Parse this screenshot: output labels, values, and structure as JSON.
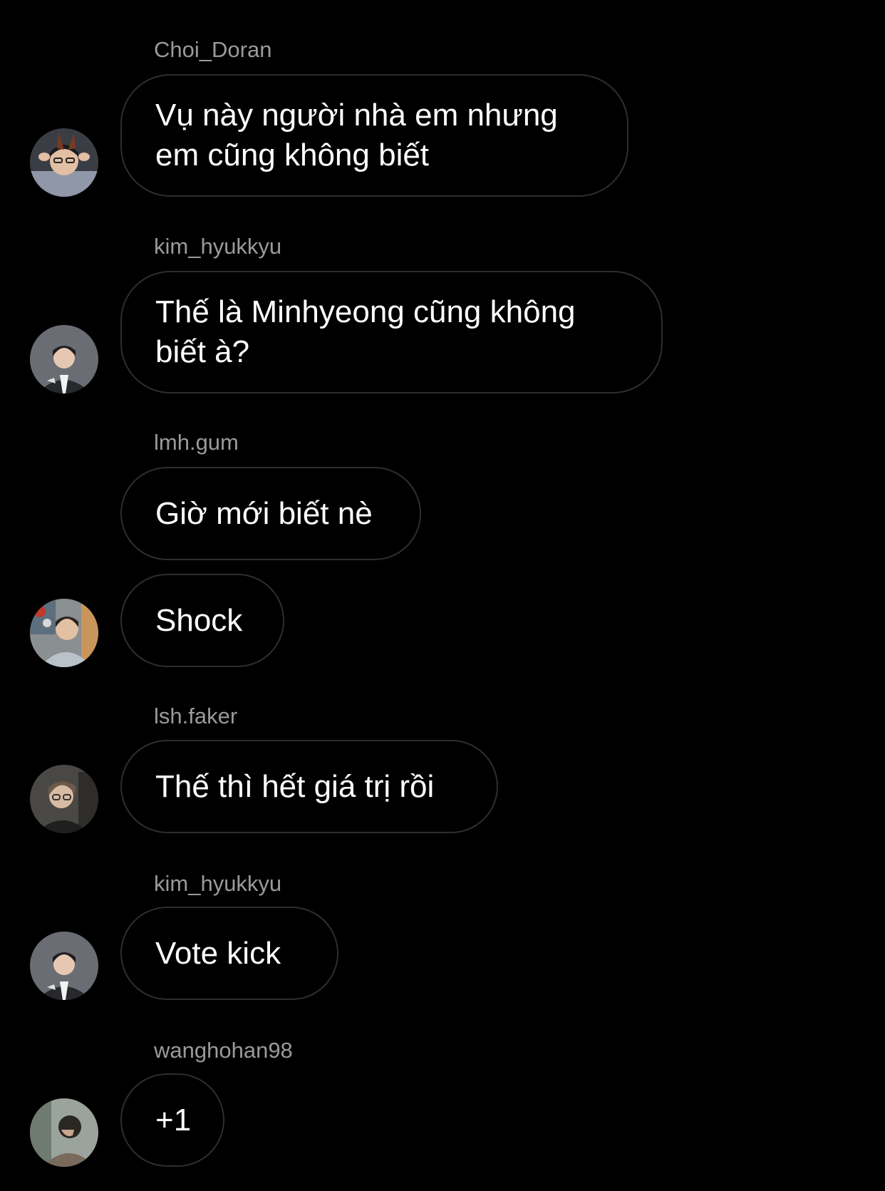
{
  "thread": {
    "messages": [
      {
        "username": "Choi_Doran",
        "text": "Vụ này người nhà em nhưng em cũng không biết",
        "avatar_icon": "user-avatar-choi-doran"
      },
      {
        "username": "kim_hyukkyu",
        "text": "Thế là Minhyeong cũng không biết à?",
        "avatar_icon": "user-avatar-kim-hyukkyu"
      },
      {
        "username": "lmh.gum",
        "text": "Giờ mới biết nè",
        "avatar_icon": ""
      },
      {
        "username": "",
        "text": "Shock",
        "avatar_icon": "user-avatar-lmh-gum"
      },
      {
        "username": "lsh.faker",
        "text": "Thế thì hết giá trị rồi",
        "avatar_icon": "user-avatar-lsh-faker"
      },
      {
        "username": "kim_hyukkyu",
        "text": "Vote kick",
        "avatar_icon": "user-avatar-kim-hyukkyu"
      },
      {
        "username": "wanghohan98",
        "text": "+1",
        "avatar_icon": "user-avatar-wanghohan98"
      }
    ]
  },
  "colors": {
    "background": "#000000",
    "bubble_border": "#2e2e2e",
    "username_text": "#9a9a9a",
    "message_text": "#ffffff"
  }
}
